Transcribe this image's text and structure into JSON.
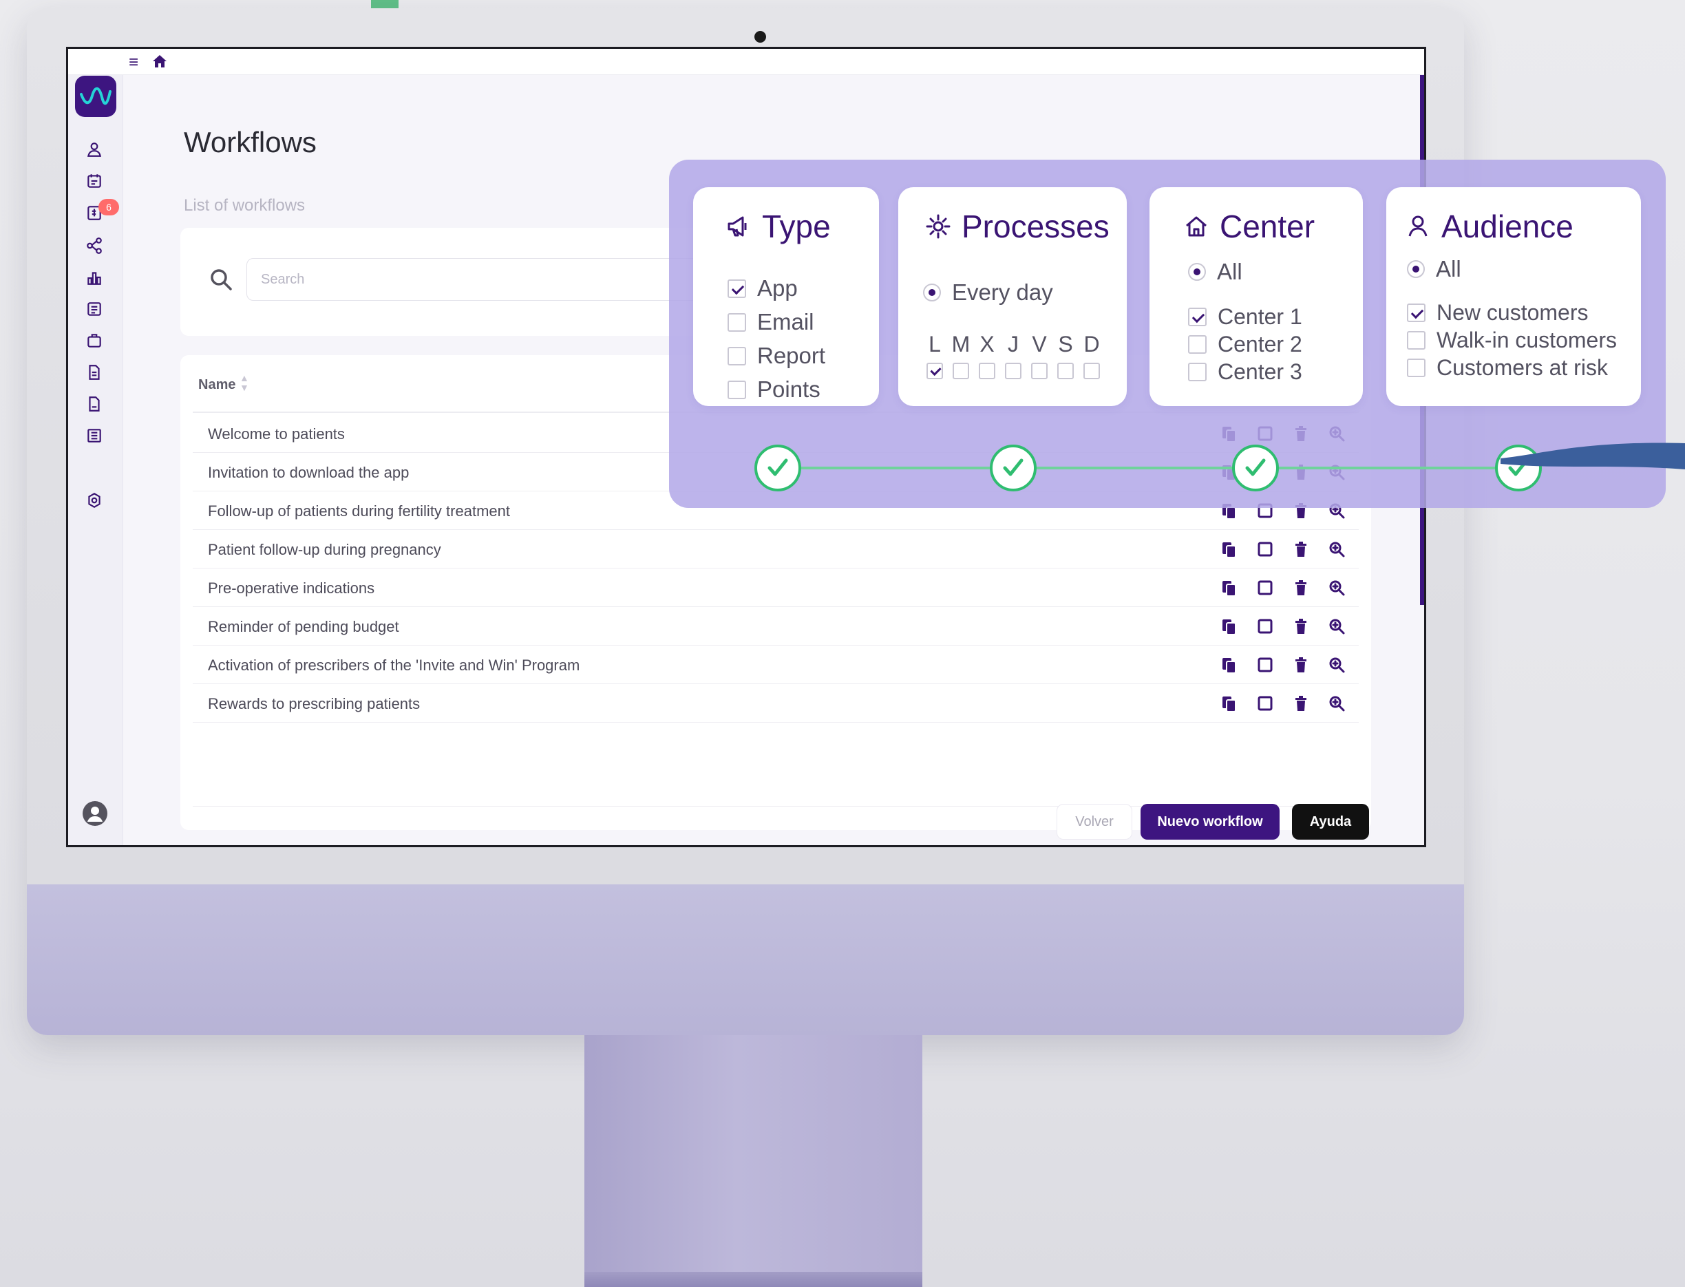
{
  "screen": {
    "topbar": {
      "menu_icon": "hamburger-icon",
      "home_icon": "home-icon"
    },
    "sidebar": {
      "badge_count": "6",
      "items": [
        "user-icon",
        "calendar-icon",
        "billing-icon",
        "share-icon",
        "chart-icon",
        "list-icon",
        "briefcase-icon",
        "document-icon",
        "file-icon",
        "news-icon",
        "settings-icon"
      ]
    },
    "page_title": "Workflows",
    "page_subtitle": "List of workflows",
    "search": {
      "placeholder": "Search"
    },
    "table": {
      "header_name": "Name",
      "rows": [
        "Welcome to patients",
        "Invitation to download the app",
        "Follow-up of patients during fertility treatment",
        "Patient follow-up during pregnancy",
        "Pre-operative indications",
        "Reminder of pending budget",
        "Activation of prescribers of the 'Invite and Win' Program",
        "Rewards to prescribing patients"
      ],
      "row_actions": [
        "copy-icon",
        "checkbox-icon",
        "trash-icon",
        "zoom-icon"
      ]
    },
    "buttons": {
      "back": "Volver",
      "new_workflow": "Nuevo workflow",
      "help": "Ayuda"
    }
  },
  "overlay": {
    "type": {
      "title": "Type",
      "options": [
        {
          "label": "App",
          "checked": true
        },
        {
          "label": "Email",
          "checked": false
        },
        {
          "label": "Report",
          "checked": false
        },
        {
          "label": "Points",
          "checked": false
        }
      ]
    },
    "processes": {
      "title": "Processes",
      "frequency_label": "Every day",
      "days": [
        {
          "label": "L",
          "checked": true
        },
        {
          "label": "M",
          "checked": false
        },
        {
          "label": "X",
          "checked": false
        },
        {
          "label": "J",
          "checked": false
        },
        {
          "label": "V",
          "checked": false
        },
        {
          "label": "S",
          "checked": false
        },
        {
          "label": "D",
          "checked": false
        }
      ]
    },
    "center": {
      "title": "Center",
      "all_label": "All",
      "options": [
        {
          "label": "Center 1",
          "checked": true
        },
        {
          "label": "Center 2",
          "checked": false
        },
        {
          "label": "Center 3",
          "checked": false
        }
      ]
    },
    "audience": {
      "title": "Audience",
      "all_label": "All",
      "options": [
        {
          "label": "New customers",
          "checked": true
        },
        {
          "label": "Walk-in customers",
          "checked": false
        },
        {
          "label": "Customers at risk",
          "checked": false
        }
      ]
    }
  },
  "colors": {
    "brand": "#3d1580",
    "accent_green": "#2fbd70",
    "overlay": "#b2a8e8",
    "badge": "#ff6b6b"
  }
}
